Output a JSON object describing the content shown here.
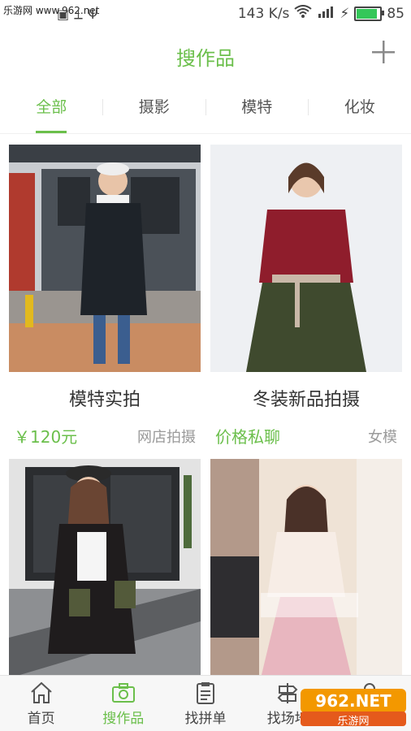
{
  "status_bar": {
    "watermark_site": "乐游网 www.962.net",
    "speed": "143 K/s",
    "battery_level": "85",
    "battery_color": "#34c759"
  },
  "header": {
    "title": "搜作品",
    "add_icon": "plus-icon"
  },
  "tabs": [
    {
      "label": "全部",
      "active": true
    },
    {
      "label": "摄影",
      "active": false
    },
    {
      "label": "模特",
      "active": false
    },
    {
      "label": "化妆",
      "active": false
    }
  ],
  "cards": [
    {
      "title": "模特实拍",
      "price": "￥120元",
      "tag": "网店拍摄"
    },
    {
      "title": "冬装新品拍摄",
      "price": "价格私聊",
      "tag": "女模"
    },
    {
      "title": "",
      "price": "",
      "tag": ""
    },
    {
      "title": "",
      "price": "",
      "tag": ""
    }
  ],
  "bottom_nav": [
    {
      "label": "首页",
      "icon": "home-icon",
      "active": false
    },
    {
      "label": "搜作品",
      "icon": "camera-icon",
      "active": true
    },
    {
      "label": "找拼单",
      "icon": "clipboard-icon",
      "active": false
    },
    {
      "label": "找场地",
      "icon": "signpost-icon",
      "active": false
    },
    {
      "label": "",
      "icon": "profile-icon",
      "active": false
    }
  ],
  "watermark": {
    "text": "962.NET",
    "subtext": "乐游网"
  },
  "colors": {
    "accent": "#6bbf4b",
    "muted": "#9a9a9a"
  }
}
